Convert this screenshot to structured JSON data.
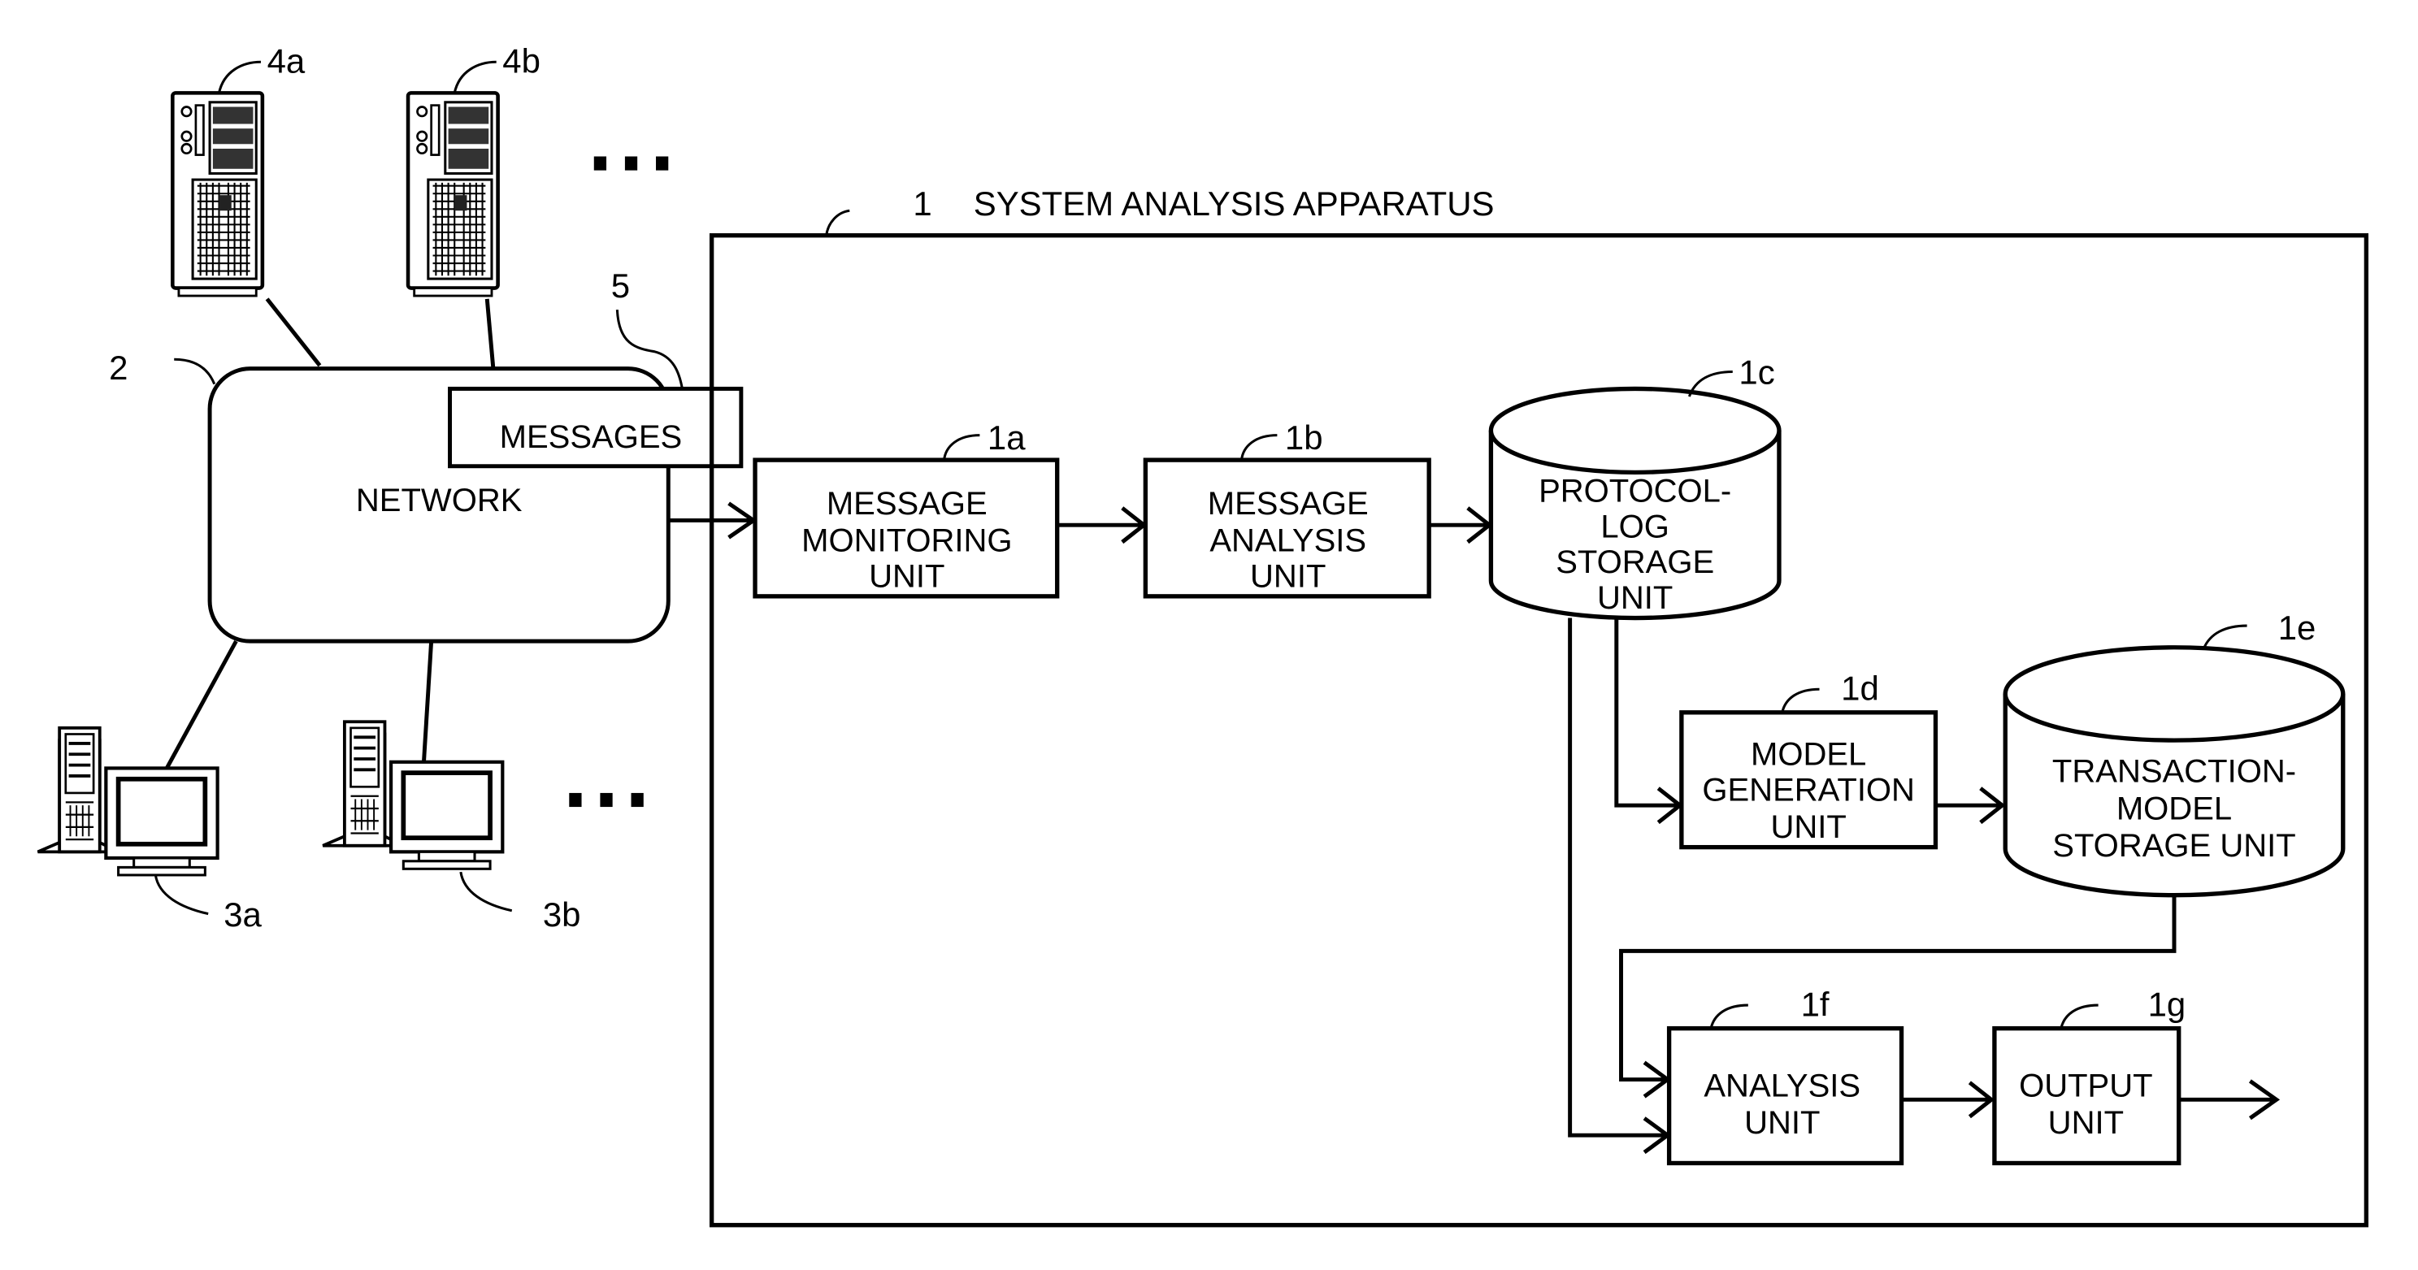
{
  "title": "SYSTEM ANALYSIS APPARATUS",
  "apparatus_ref": "1",
  "network": {
    "ref": "2",
    "label": "NETWORK"
  },
  "messages": {
    "ref": "5",
    "label": "MESSAGES"
  },
  "servers": [
    {
      "ref": "4a"
    },
    {
      "ref": "4b"
    }
  ],
  "clients": [
    {
      "ref": "3a"
    },
    {
      "ref": "3b"
    }
  ],
  "ellipsis": "▪ ▪ ▪",
  "units": {
    "monitoring": {
      "ref": "1a",
      "lines": [
        "MESSAGE",
        "MONITORING",
        "UNIT"
      ]
    },
    "analysis_msg": {
      "ref": "1b",
      "lines": [
        "MESSAGE",
        "ANALYSIS",
        "UNIT"
      ]
    },
    "protocol_log": {
      "ref": "1c",
      "lines": [
        "PROTOCOL-",
        "LOG",
        "STORAGE",
        "UNIT"
      ]
    },
    "model_gen": {
      "ref": "1d",
      "lines": [
        "MODEL",
        "GENERATION",
        "UNIT"
      ]
    },
    "transaction": {
      "ref": "1e",
      "lines": [
        "TRANSACTION-",
        "MODEL",
        "STORAGE UNIT"
      ]
    },
    "analysis": {
      "ref": "1f",
      "lines": [
        "ANALYSIS",
        "UNIT"
      ]
    },
    "output": {
      "ref": "1g",
      "lines": [
        "OUTPUT",
        "UNIT"
      ]
    }
  }
}
